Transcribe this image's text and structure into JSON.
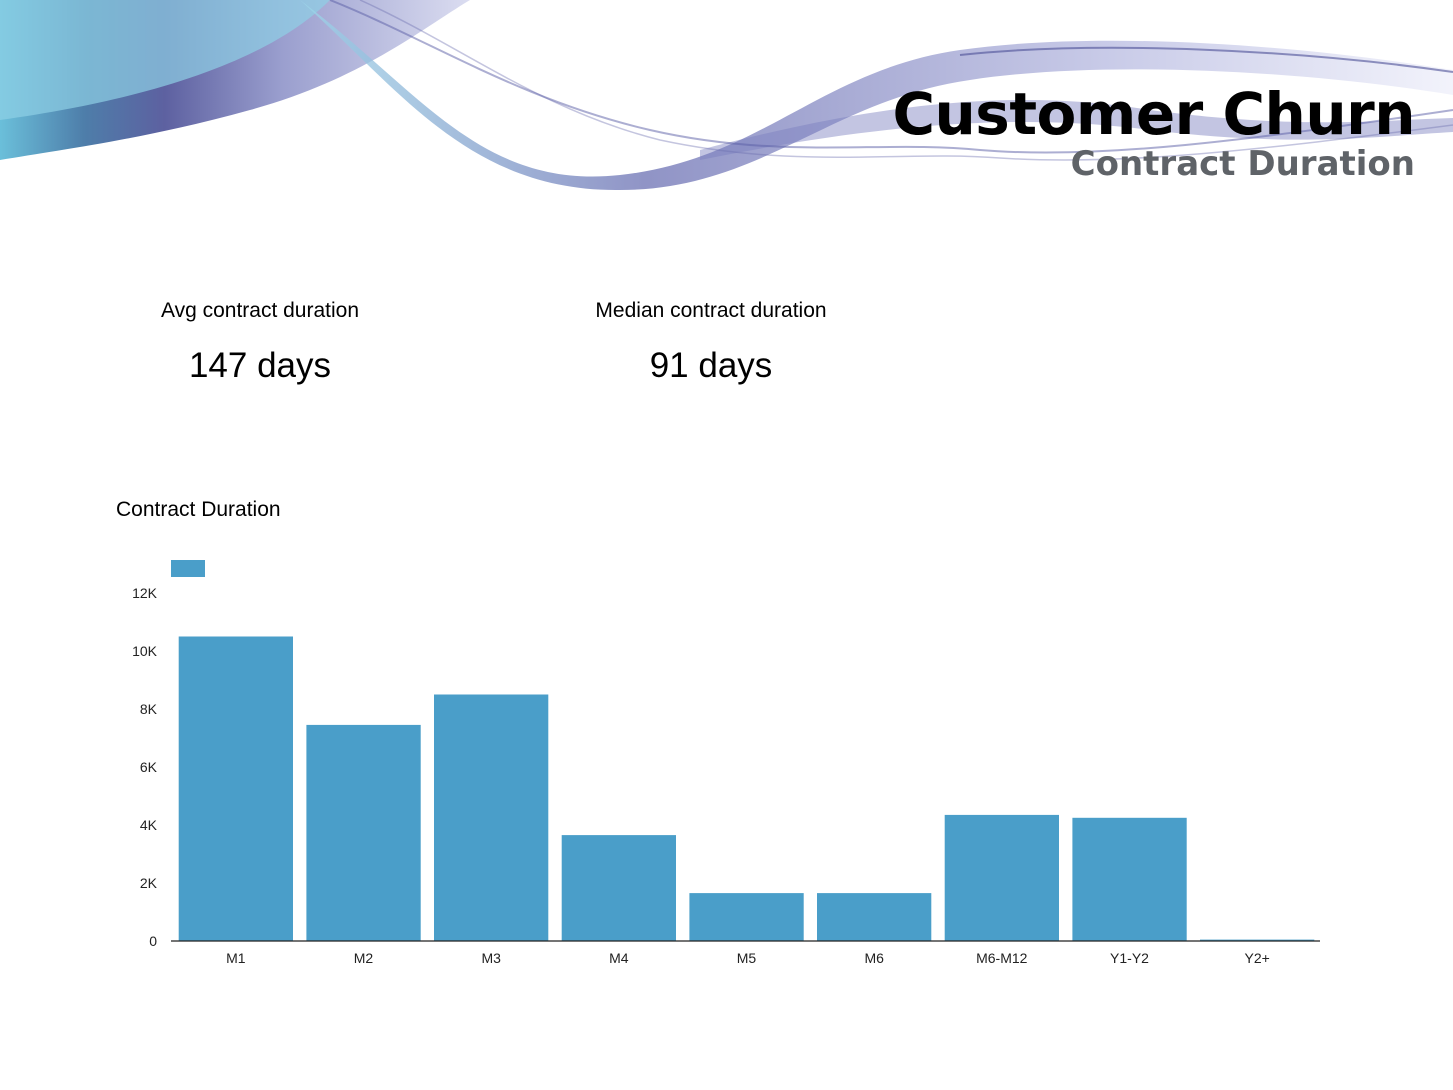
{
  "header": {
    "title": "Customer Churn",
    "subtitle": "Contract Duration"
  },
  "kpis": [
    {
      "label": "Avg contract duration",
      "value": "147 days"
    },
    {
      "label": "Median contract duration",
      "value": "91 days"
    }
  ],
  "colors": {
    "bar": "#4a9ec9",
    "axis": "#222222",
    "subtitle": "#5f6368"
  },
  "chart_data": {
    "type": "bar",
    "title": "Contract Duration",
    "categories": [
      "M1",
      "M2",
      "M3",
      "M4",
      "M5",
      "M6",
      "M6-M12",
      "Y1-Y2",
      "Y2+"
    ],
    "values": [
      10500,
      7450,
      8500,
      3650,
      1650,
      1650,
      4350,
      4250,
      50
    ],
    "ylim": [
      0,
      12000
    ],
    "yticks": [
      0,
      2000,
      4000,
      6000,
      8000,
      10000,
      12000
    ],
    "ytick_labels": [
      "0",
      "2K",
      "4K",
      "6K",
      "8K",
      "10K",
      "12K"
    ],
    "xlabel": "",
    "ylabel": "",
    "grid": false,
    "legend": "top-left"
  }
}
